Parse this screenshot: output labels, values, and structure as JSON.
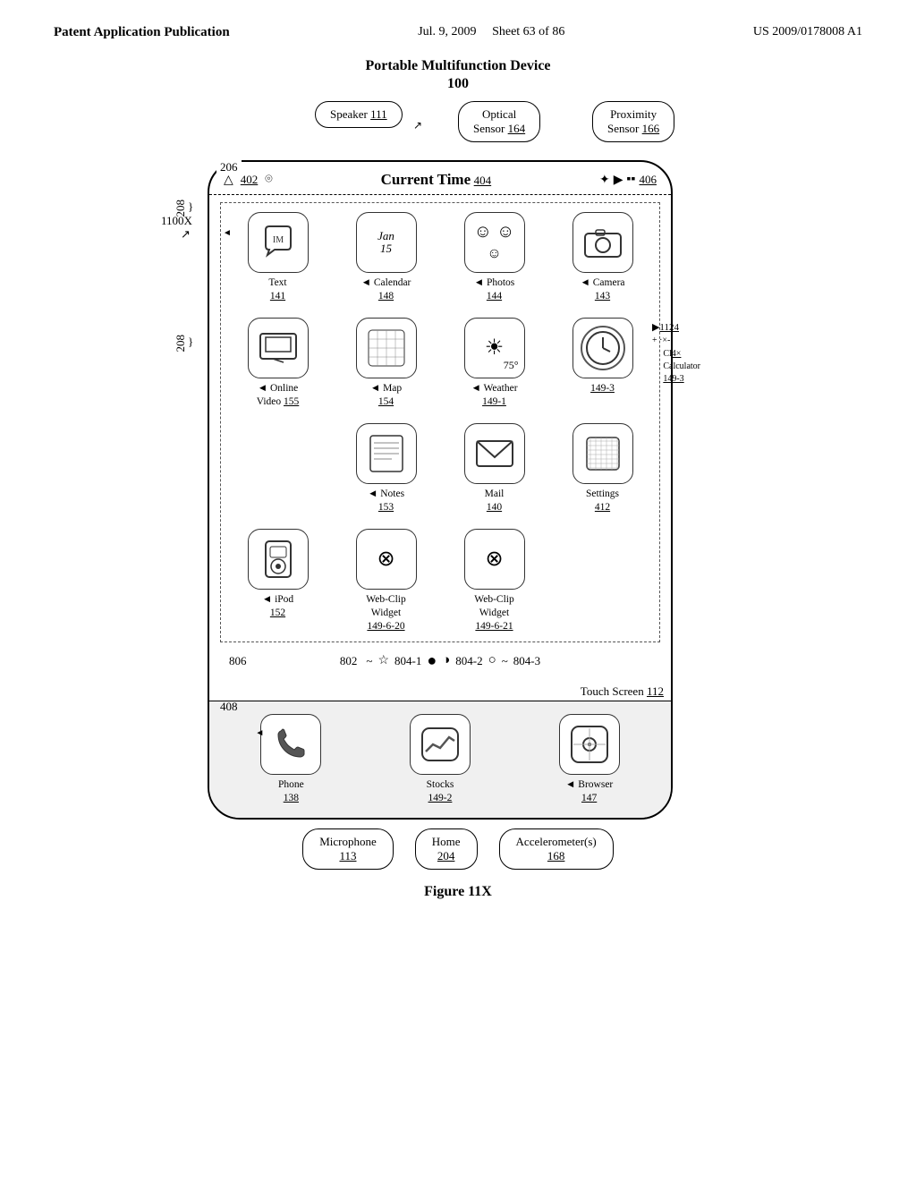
{
  "header": {
    "left": "Patent Application Publication",
    "center_date": "Jul. 9, 2009",
    "center_sheet": "Sheet 63 of 86",
    "right": "US 2009/0178008 A1"
  },
  "diagram": {
    "device_title": "Portable Multifunction Device",
    "device_number": "100",
    "label_206": "206",
    "label_208_top": "208",
    "label_208_mid": "208",
    "label_1100x": "1100X",
    "sensors_top": [
      {
        "label": "Speaker",
        "number": "111"
      },
      {
        "label": "Optical\nSensor",
        "number": "164"
      },
      {
        "label": "Proximity\nSensor",
        "number": "166"
      }
    ],
    "status_bar": {
      "left": "402",
      "signal_icon": "▲ ⌾",
      "center": "Current Time",
      "center_number": "404",
      "right_icons": "✦ ▶ ▪ 406"
    },
    "apps": [
      {
        "name": "Text",
        "number": "141",
        "icon": "💬",
        "extra": "IM"
      },
      {
        "name": "Calendar",
        "number": "148",
        "icon": "📅",
        "extra": "Jan\n15"
      },
      {
        "name": "Photos",
        "number": "144",
        "icon": "😊",
        "extra": "☺ ☺ ☺"
      },
      {
        "name": "Camera",
        "number": "143",
        "icon": "📷",
        "extra": ""
      },
      {
        "name": "Online\nVideo",
        "number": "155",
        "icon": "🖥",
        "extra": ""
      },
      {
        "name": "Map",
        "number": "154",
        "icon": "🗺",
        "extra": ""
      },
      {
        "name": "Weather",
        "number": "149-1",
        "icon": "☀",
        "extra": "75°"
      },
      {
        "name": "Clock",
        "number": "149-3",
        "icon": "🕐",
        "extra": ""
      },
      {
        "name": "Notes",
        "number": "153",
        "icon": "📝",
        "extra": ""
      },
      {
        "name": "Mail",
        "number": "140",
        "icon": "✉",
        "extra": ""
      },
      {
        "name": "Settings",
        "number": "412",
        "icon": "⚙",
        "extra": ""
      },
      {
        "name": "iPod",
        "number": "152",
        "icon": "🎵",
        "extra": ""
      },
      {
        "name": "Web-Clip\nWidget",
        "number": "149-6-20",
        "icon": "⊗",
        "extra": ""
      },
      {
        "name": "Web-Clip\nWidget",
        "number": "149-6-21",
        "icon": "⊗",
        "extra": ""
      }
    ],
    "dock_indicators": {
      "label_802": "802",
      "label_806": "806",
      "items": [
        "☆",
        "●",
        "◑",
        "○",
        "~"
      ],
      "label_804_1": "804-1",
      "label_804_2": "804-2",
      "label_804_3": "804-3"
    },
    "dock_apps": [
      {
        "name": "Phone",
        "number": "138",
        "icon": "📞"
      },
      {
        "name": "Stocks",
        "number": "149-2",
        "icon": "📈"
      },
      {
        "name": "Browser",
        "number": "147",
        "icon": "⚙"
      }
    ],
    "touch_screen_label": "Touch Screen 112",
    "bottom_sensors": [
      {
        "label": "Microphone",
        "number": "113"
      },
      {
        "label": "Home",
        "number": "204"
      },
      {
        "label": "Accelerometer(s)",
        "number": "168"
      }
    ],
    "label_408": "408",
    "calc_extra": {
      "label": "Cl",
      "number": "14×",
      "name": "Calculator",
      "number2": "149-3"
    },
    "label_1124": "1124",
    "figure": "Figure 11X"
  }
}
